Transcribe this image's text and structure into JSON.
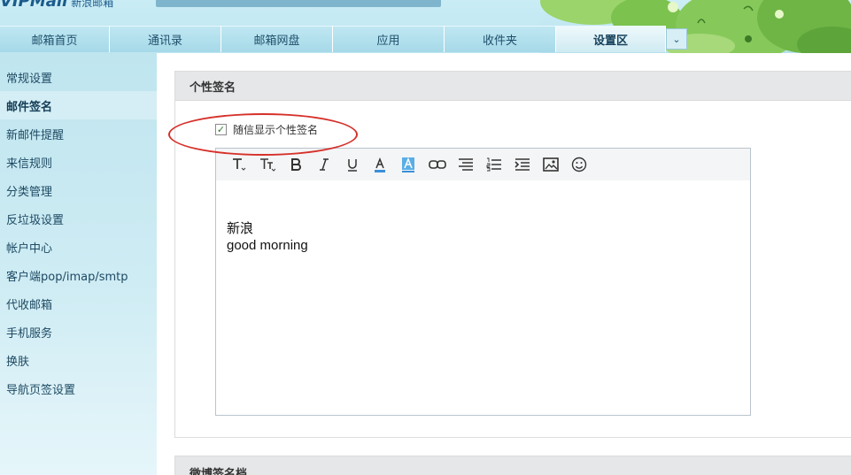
{
  "header": {
    "logo_text": "VIPMail",
    "logo_sub": "新浪邮箱"
  },
  "nav": {
    "tabs": [
      {
        "label": "邮箱首页",
        "active": false
      },
      {
        "label": "通讯录",
        "active": false
      },
      {
        "label": "邮箱网盘",
        "active": false
      },
      {
        "label": "应用",
        "active": false
      },
      {
        "label": "收件夹",
        "active": false
      },
      {
        "label": "设置区",
        "active": true
      }
    ],
    "more_icon": "chevron-down-icon",
    "more_glyph": "⌄"
  },
  "sidebar": {
    "items": [
      {
        "label": "常规设置",
        "active": false
      },
      {
        "label": "邮件签名",
        "active": true
      },
      {
        "label": "新邮件提醒",
        "active": false
      },
      {
        "label": "来信规则",
        "active": false
      },
      {
        "label": "分类管理",
        "active": false
      },
      {
        "label": "反垃圾设置",
        "active": false
      },
      {
        "label": "帐户中心",
        "active": false
      },
      {
        "label": "客户端pop/imap/smtp",
        "active": false
      },
      {
        "label": "代收邮箱",
        "active": false
      },
      {
        "label": "手机服务",
        "active": false
      },
      {
        "label": "换肤",
        "active": false
      },
      {
        "label": "导航页签设置",
        "active": false
      }
    ]
  },
  "signature": {
    "section_title": "个性签名",
    "checkbox_label": "随信显示个性签名",
    "checkbox_checked": true,
    "checkbox_glyph": "✓",
    "toolbar": [
      "font-family-icon",
      "font-size-icon",
      "bold-icon",
      "italic-icon",
      "underline-icon",
      "font-color-icon",
      "highlight-color-icon",
      "link-icon",
      "align-icon",
      "ordered-list-icon",
      "indent-icon",
      "insert-image-icon",
      "emoji-icon"
    ],
    "body_line1": "新浪",
    "body_line2": "good morning"
  },
  "weibo": {
    "section_title": "微博签名档"
  },
  "colors": {
    "highlight_annotation": "#d6302a",
    "sidebar_bg": "#bfe5ef",
    "nav_tab_bg": "#a6d9e8"
  }
}
